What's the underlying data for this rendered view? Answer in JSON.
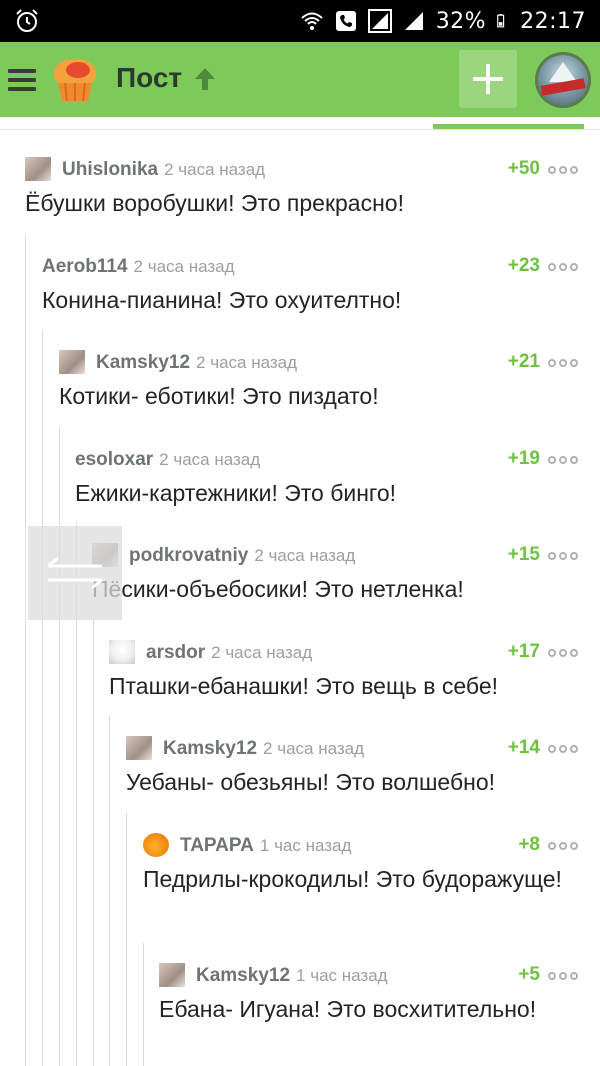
{
  "status_bar": {
    "battery_percent": "32%",
    "time": "22:17",
    "icons": [
      "alarm-icon",
      "wifi-icon",
      "phone-icon",
      "signal-icon",
      "signal-icon",
      "battery-icon"
    ]
  },
  "app_bar": {
    "title": "Пост",
    "icons": [
      "menu-icon",
      "logo-icon",
      "arrow-up-icon",
      "plus-icon",
      "avatar"
    ]
  },
  "colors": {
    "accent": "#7dca5b",
    "rating": "#6fc143",
    "author": "#6e7571",
    "text": "#242424"
  },
  "comments": [
    {
      "author": "Uhislonika",
      "time": "2 часа назад",
      "rating": "+50",
      "text": "Ёбушки воробушки! Это прекрасно!",
      "depth": 0,
      "avatar": "photo"
    },
    {
      "author": "Aerob114",
      "time": "2 часа назад",
      "rating": "+23",
      "text": "Конина-пианина! Это охуителтно!",
      "depth": 1,
      "avatar": "none"
    },
    {
      "author": "Kamsky12",
      "time": "2 часа назад",
      "rating": "+21",
      "text": "Котики- еботики! Это пиздато!",
      "depth": 2,
      "avatar": "photo"
    },
    {
      "author": "esoloxar",
      "time": "2 часа назад",
      "rating": "+19",
      "text": "Ежики-картежники! Это бинго!",
      "depth": 3,
      "avatar": "none"
    },
    {
      "author": "podkrovatniy",
      "time": "2 часа назад",
      "rating": "+15",
      "text": "Пёсики-объебосики! Это нетленка!",
      "depth": 4,
      "avatar": "photo"
    },
    {
      "author": "arsdor",
      "time": "2 часа назад",
      "rating": "+17",
      "text": "Пташки-ебанашки! Это вещь в себе!",
      "depth": 5,
      "avatar": "bird"
    },
    {
      "author": "Kamsky12",
      "time": "2 часа назад",
      "rating": "+14",
      "text": "Уебаны- обезьяны! Это волшебно!",
      "depth": 6,
      "avatar": "photo"
    },
    {
      "author": "TAPAPA",
      "time": "1 час назад",
      "rating": "+8",
      "text": "Педрилы-крокодилы! Это будоражуще!",
      "depth": 7,
      "avatar": "orange"
    },
    {
      "author": "Kamsky12",
      "time": "1 час назад",
      "rating": "+5",
      "text": "Ебана- Игуана! Это восхитительно!",
      "depth": 8,
      "avatar": "photo"
    }
  ]
}
